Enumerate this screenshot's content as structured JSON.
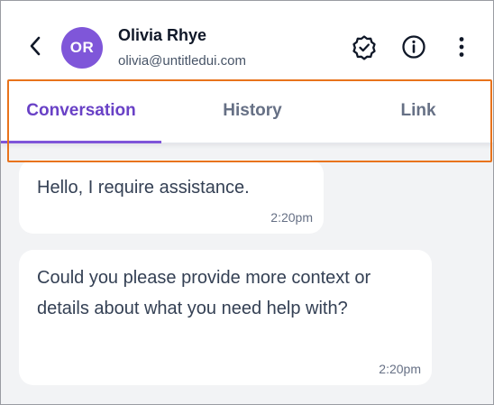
{
  "contact": {
    "initials": "OR",
    "name": "Olivia Rhye",
    "email": "olivia@untitledui.com"
  },
  "icons": {
    "back": "chevron-left-icon",
    "verified": "verified-badge-icon",
    "info": "info-icon",
    "more": "more-vertical-icon"
  },
  "tabs": [
    {
      "label": "Conversation",
      "active": true
    },
    {
      "label": "History",
      "active": false
    },
    {
      "label": "Link",
      "active": false
    }
  ],
  "messages": [
    {
      "text": "Hello, I require assistance.",
      "time": "2:20pm"
    },
    {
      "text": "Could you please provide more context or details about what you need help with?",
      "time": "2:20pm"
    }
  ],
  "colors": {
    "accent": "#7f56d9",
    "accent_text": "#6941c6",
    "highlight_border": "#e8731c",
    "chat_background": "#f2f3f5"
  }
}
